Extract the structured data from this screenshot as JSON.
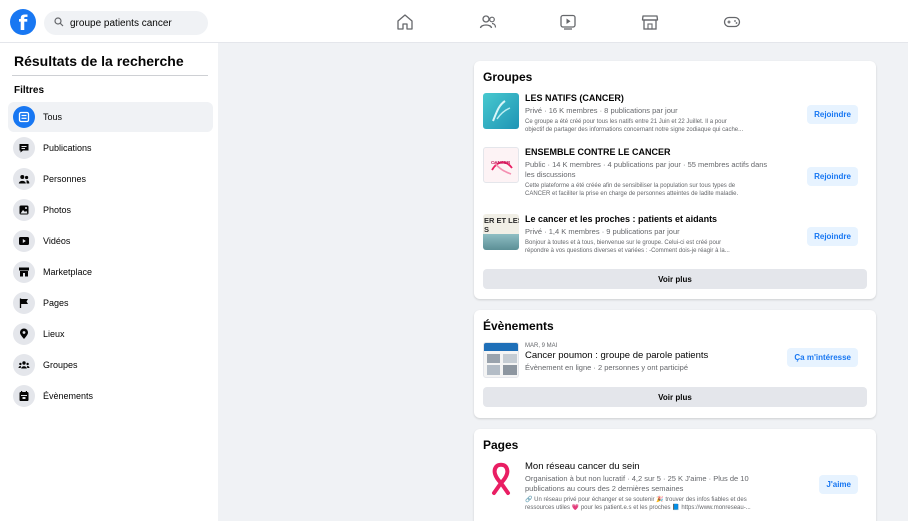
{
  "topbar": {
    "logo": "f",
    "search_value": "groupe patients cancer",
    "nav_icons": [
      "home-icon",
      "friends-icon",
      "watch-icon",
      "marketplace-icon",
      "gaming-icon"
    ]
  },
  "sidebar": {
    "title": "Résultats de la recherche",
    "filters_label": "Filtres",
    "items": [
      {
        "label": "Tous",
        "icon": "all-icon",
        "active": true
      },
      {
        "label": "Publications",
        "icon": "posts-icon"
      },
      {
        "label": "Personnes",
        "icon": "people-icon"
      },
      {
        "label": "Photos",
        "icon": "photos-icon"
      },
      {
        "label": "Vidéos",
        "icon": "videos-icon"
      },
      {
        "label": "Marketplace",
        "icon": "marketplace-icon"
      },
      {
        "label": "Pages",
        "icon": "flag-icon"
      },
      {
        "label": "Lieux",
        "icon": "location-icon"
      },
      {
        "label": "Groupes",
        "icon": "groups-icon"
      },
      {
        "label": "Évènements",
        "icon": "calendar-icon"
      }
    ]
  },
  "groups": {
    "title": "Groupes",
    "items": [
      {
        "name": "LES NATIFS (CANCER)",
        "meta": "Privé · 16 K membres · 8 publications par jour",
        "desc1": "Ce groupe a été créé pour tous les natifs entre 21 Juin et 22 Juillet. Il a pour",
        "desc2": "objectif de partager des informations concernant notre signe zodiaque qui cache...",
        "button": "Rejoindre"
      },
      {
        "name": "ENSEMBLE CONTRE LE CANCER",
        "meta1": "Public · 14 K membres · 4 publications par jour · 55 membres actifs dans",
        "meta2": "les discussions",
        "desc1": "Cette plateforme a été créée afin de sensibiliser la population sur tous types de",
        "desc2": "CANCER et faciliter la prise en charge de personnes atteintes de ladite maladie.",
        "thumb_text": "CANCER",
        "button": "Rejoindre"
      },
      {
        "name": "Le cancer et les proches : patients et aidants",
        "meta": "Privé · 1,4 K membres · 9 publications par jour",
        "desc1": "Bonjour à toutes et à tous, bienvenue sur le groupe. Celui-ci est créé pour",
        "desc2": "répondre à vos questions diverses et variées : -Comment dois-je réagir à la...",
        "thumb_text1": "ER ET LES",
        "thumb_text2": "S",
        "button": "Rejoindre"
      }
    ],
    "see_more": "Voir plus"
  },
  "events": {
    "title": "Évènements",
    "item": {
      "date": "MAR, 9 MAI",
      "name": "Cancer poumon : groupe de parole patients",
      "meta": "Évènement en ligne · 2 personnes y ont participé",
      "button": "Ça m'intéresse"
    },
    "see_more": "Voir plus"
  },
  "pages": {
    "title": "Pages",
    "item": {
      "name": "Mon réseau cancer du sein",
      "meta1": "Organisation à but non lucratif · 4,2 sur 5 · 25 K J'aime · Plus de 10",
      "meta2": "publications au cours des 2 dernières semaines",
      "desc1": "🔗 Un réseau privé pour échanger et se soutenir 🎉 trouver des infos fiables et des",
      "desc2": "ressources utiles 💗 pour les patient.e.s et les proches 📘 https://www.monreseau-...",
      "button": "J'aime"
    }
  },
  "colors": {
    "brand": "#1877f2",
    "button_bg": "#e7f3ff",
    "background": "#f0f2f5",
    "ribbon": "#e91e63"
  }
}
